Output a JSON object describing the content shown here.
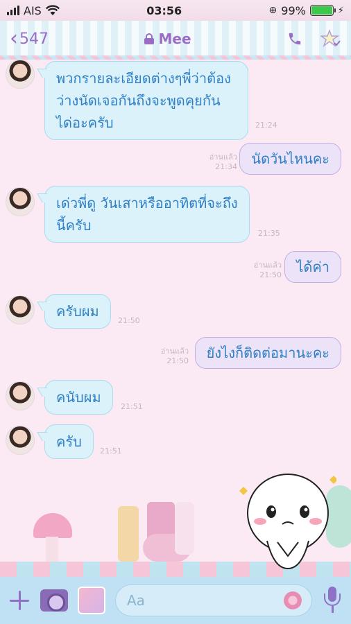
{
  "status_bar": {
    "carrier": "AIS",
    "time": "03:56",
    "battery_percent": "99%",
    "battery_level": 0.99
  },
  "header": {
    "back_count": "547",
    "chat_name": "Mee",
    "icons": [
      "chevron-left-icon",
      "lock-icon",
      "phone-icon",
      "settings-icon"
    ]
  },
  "messages": [
    {
      "side": "in",
      "text_lines": [
        "พวกรายละเอียดต่างๆพี่ว่าต้อง",
        "ว่างนัดเจอกันถึงจะพูดคุยกัน",
        "ได่อะครับ"
      ],
      "time": "21:24"
    },
    {
      "side": "out",
      "text": "นัดวันไหนคะ",
      "read": "อ่านแล้ว",
      "time": "21:34"
    },
    {
      "side": "in",
      "text_lines": [
        "เด่วพี่ดู วันเสาหรืออาทิตที่จะถึง",
        "นี้ครับ"
      ],
      "time": "21:35"
    },
    {
      "side": "out",
      "text": "ได้ค่า",
      "read": "อ่านแล้ว",
      "time": "21:50"
    },
    {
      "side": "in",
      "text_lines": [
        "ครับผม"
      ],
      "time": "21:50"
    },
    {
      "side": "out",
      "text": "ยังไงก็ติดต่อมานะคะ",
      "read": "อ่านแล้ว",
      "time": "21:50"
    },
    {
      "side": "in",
      "text_lines": [
        "คนับผม"
      ],
      "time": "21:51"
    },
    {
      "side": "in",
      "text_lines": [
        "ครับ"
      ],
      "time": "21:51"
    }
  ],
  "input_bar": {
    "placeholder": "Aa",
    "icons": [
      "plus-icon",
      "camera-icon",
      "gallery-icon",
      "emoji-icon",
      "microphone-icon"
    ]
  },
  "colors": {
    "accent": "#9a6cc4",
    "incoming_bubble": "#dcf2fb",
    "outgoing_bubble": "#ece3f8",
    "message_text": "#2f7fc4"
  }
}
